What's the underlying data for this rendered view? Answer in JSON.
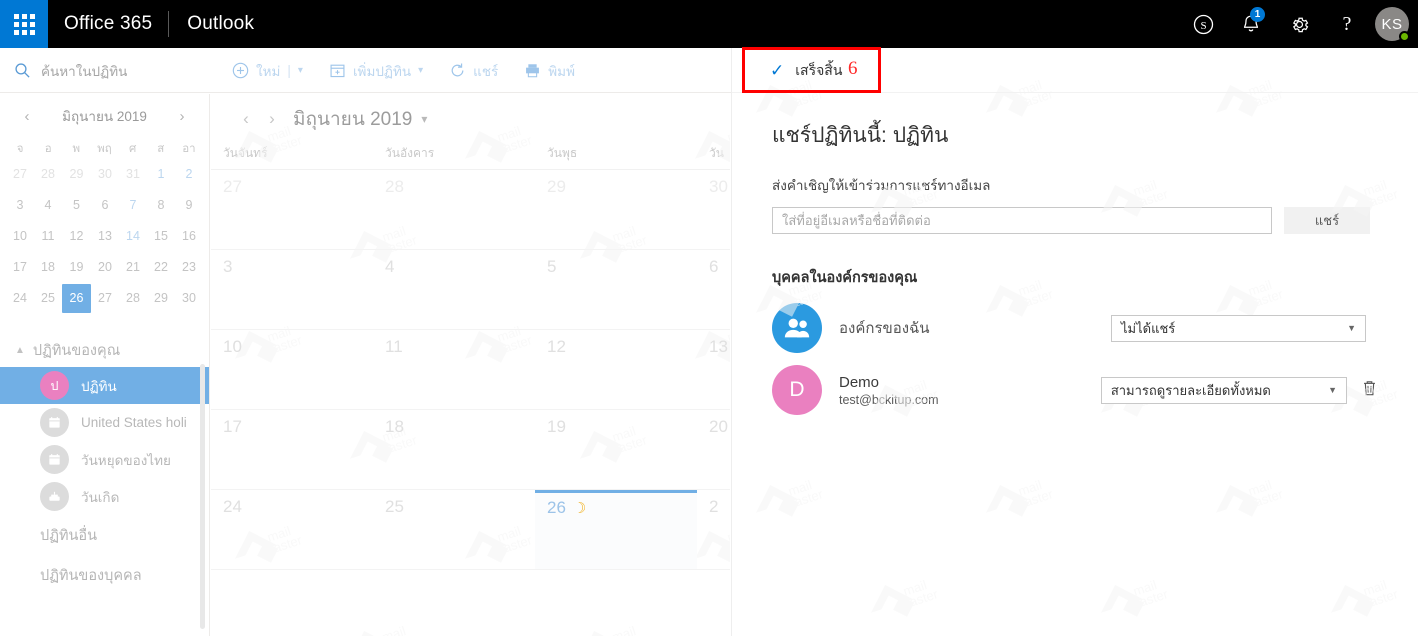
{
  "topbar": {
    "waffle_icon": "app-launcher-icon",
    "brand": "Office 365",
    "app_name": "Outlook",
    "icons": [
      {
        "name": "skype-icon",
        "glyph": "S"
      },
      {
        "name": "notifications-bell-icon",
        "badge": "1"
      },
      {
        "name": "settings-gear-icon"
      },
      {
        "name": "help-icon",
        "glyph": "?"
      }
    ],
    "avatar_initials": "KS"
  },
  "commandbar": {
    "search_placeholder": "ค้นหาในปฏิทิน",
    "items": [
      {
        "label": "ใหม่",
        "icon": "plus-circle-icon",
        "has_caret": true,
        "separator": "|"
      },
      {
        "label": "เพิ่มปฏิทิน",
        "icon": "calendar-add-icon",
        "has_caret": true
      },
      {
        "label": "แชร์",
        "icon": "share-icon",
        "has_caret": false
      },
      {
        "label": "พิมพ์",
        "icon": "printer-icon",
        "has_caret": false
      }
    ]
  },
  "mini_calendar": {
    "title": "มิถุนายน 2019",
    "prev_label": "‹",
    "next_label": "›",
    "dow": [
      "จ",
      "อ",
      "พ",
      "พฤ",
      "ศ",
      "ส",
      "อา"
    ],
    "weeks": [
      [
        {
          "d": "27",
          "s": "out"
        },
        {
          "d": "28",
          "s": "out"
        },
        {
          "d": "29",
          "s": "out"
        },
        {
          "d": "30",
          "s": "out"
        },
        {
          "d": "31",
          "s": "out"
        },
        {
          "d": "1",
          "s": "wk"
        },
        {
          "d": "2",
          "s": "wk"
        }
      ],
      [
        {
          "d": "3",
          "s": ""
        },
        {
          "d": "4",
          "s": ""
        },
        {
          "d": "5",
          "s": ""
        },
        {
          "d": "6",
          "s": ""
        },
        {
          "d": "7",
          "s": "wk"
        },
        {
          "d": "8",
          "s": ""
        },
        {
          "d": "9",
          "s": ""
        }
      ],
      [
        {
          "d": "10",
          "s": ""
        },
        {
          "d": "11",
          "s": ""
        },
        {
          "d": "12",
          "s": ""
        },
        {
          "d": "13",
          "s": ""
        },
        {
          "d": "14",
          "s": "wk"
        },
        {
          "d": "15",
          "s": ""
        },
        {
          "d": "16",
          "s": ""
        }
      ],
      [
        {
          "d": "17",
          "s": ""
        },
        {
          "d": "18",
          "s": ""
        },
        {
          "d": "19",
          "s": ""
        },
        {
          "d": "20",
          "s": ""
        },
        {
          "d": "21",
          "s": ""
        },
        {
          "d": "22",
          "s": ""
        },
        {
          "d": "23",
          "s": ""
        }
      ],
      [
        {
          "d": "24",
          "s": ""
        },
        {
          "d": "25",
          "s": ""
        },
        {
          "d": "26",
          "s": "sel"
        },
        {
          "d": "27",
          "s": ""
        },
        {
          "d": "28",
          "s": ""
        },
        {
          "d": "29",
          "s": ""
        },
        {
          "d": "30",
          "s": ""
        }
      ]
    ]
  },
  "sidebar": {
    "group_label": "ปฏิทินของคุณ",
    "calendars": [
      {
        "label": "ปฏิทิน",
        "badge": "ป",
        "color": "#ea80c0",
        "selected": true,
        "icon": "calendar-dot-icon"
      },
      {
        "label": "United States holi",
        "badge": "",
        "color": "#dcdcdc",
        "selected": false,
        "icon": "calendar-icon"
      },
      {
        "label": "วันหยุดของไทย",
        "badge": "",
        "color": "#dcdcdc",
        "selected": false,
        "icon": "calendar-icon"
      },
      {
        "label": "วันเกิด",
        "badge": "",
        "color": "#dcdcdc",
        "selected": false,
        "icon": "birthday-cake-icon"
      }
    ],
    "other_calendars": "ปฏิทินอื่น",
    "people_calendars": "ปฏิทินของบุคคล"
  },
  "calendar": {
    "month_title": "มิถุนายน 2019",
    "prev_label": "‹",
    "next_label": "›",
    "caret": "⌄",
    "dow": [
      "วันจันทร์",
      "วันอังคาร",
      "วันพุธ",
      "วัน"
    ],
    "weeks": [
      [
        {
          "d": "27",
          "out": true
        },
        {
          "d": "28",
          "out": true
        },
        {
          "d": "29",
          "out": true
        },
        {
          "d": "30",
          "out": true
        }
      ],
      [
        {
          "d": "3",
          "out": false
        },
        {
          "d": "4",
          "out": false
        },
        {
          "d": "5",
          "out": false
        },
        {
          "d": "6",
          "out": false
        }
      ],
      [
        {
          "d": "10",
          "out": false
        },
        {
          "d": "11",
          "out": false
        },
        {
          "d": "12",
          "out": false
        },
        {
          "d": "13",
          "out": false
        }
      ],
      [
        {
          "d": "17",
          "out": false
        },
        {
          "d": "18",
          "out": false
        },
        {
          "d": "19",
          "out": false
        },
        {
          "d": "20",
          "out": false
        }
      ],
      [
        {
          "d": "24",
          "out": false
        },
        {
          "d": "25",
          "out": false
        },
        {
          "d": "26",
          "out": false,
          "today": true,
          "moon": "☽"
        },
        {
          "d": "2",
          "out": false
        }
      ]
    ],
    "watermark_text": "mail master"
  },
  "panel": {
    "done_label": "เสร็จสิ้น",
    "done_check": "✓",
    "annotation_number": "6",
    "annotation_color": "#ff0000",
    "title": "แชร์ปฏิทินนี้: ปฏิทิน",
    "subtitle": "ส่งคำเชิญให้เข้าร่วมการแชร์ทางอีเมล",
    "invite_placeholder": "ใส่ที่อยู่อีเมลหรือชื่อที่ติดต่อ",
    "invite_value": "",
    "share_button": "แชร์",
    "people_header": "บุคคลในองค์กรของคุณ",
    "people": [
      {
        "name": "องค์กรของฉัน",
        "email": "",
        "avatar_letter": "",
        "avatar_color": "#2b9ae0",
        "avatar_icon": "people-group-icon",
        "permission": "ไม่ได้แชร์",
        "deletable": false
      },
      {
        "name": "Demo",
        "email": "test@bckitup.com",
        "avatar_letter": "D",
        "avatar_color": "#ea80c0",
        "avatar_icon": "user-initial-avatar",
        "permission": "สามารถดูรายละเอียดทั้งหมด",
        "deletable": true,
        "delete_icon": "trash-icon"
      }
    ]
  }
}
